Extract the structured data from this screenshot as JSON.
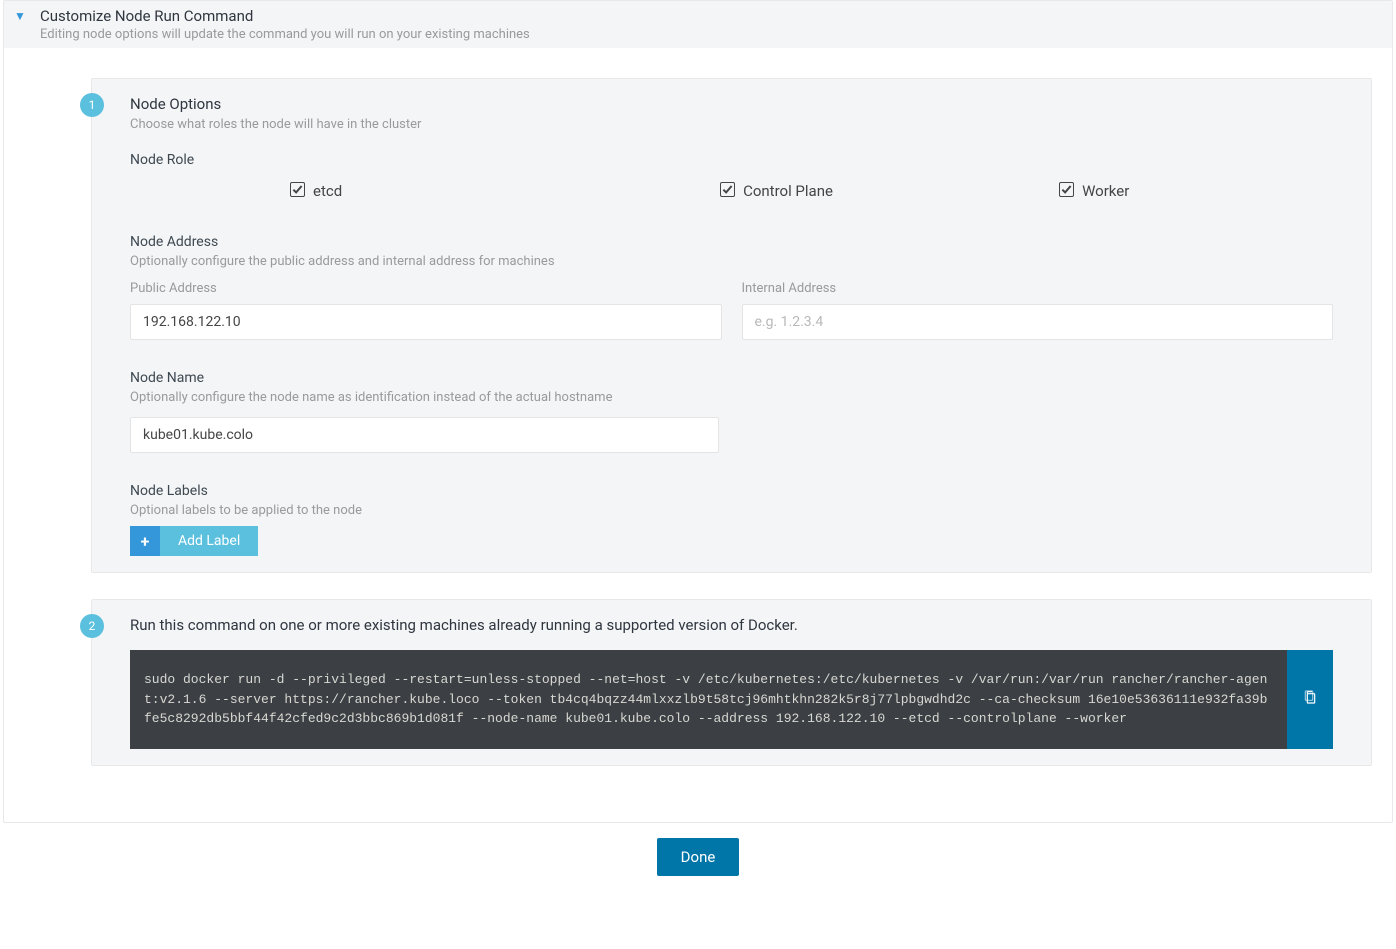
{
  "header": {
    "title": "Customize Node Run Command",
    "subtitle": "Editing node options will update the command you will run on your existing machines"
  },
  "step1": {
    "num": "1",
    "title": "Node Options",
    "subtitle": "Choose what roles the node will have in the cluster",
    "role_label": "Node Role",
    "roles": {
      "etcd": "etcd",
      "control_plane": "Control Plane",
      "worker": "Worker"
    },
    "address": {
      "label": "Node Address",
      "sub": "Optionally configure the public address and internal address for machines",
      "public_label": "Public Address",
      "public_value": "192.168.122.10",
      "internal_label": "Internal Address",
      "internal_placeholder": "e.g. 1.2.3.4"
    },
    "name": {
      "label": "Node Name",
      "sub": "Optionally configure the node name as identification instead of the actual hostname",
      "value": "kube01.kube.colo"
    },
    "labels": {
      "label": "Node Labels",
      "sub": "Optional labels to be applied to the node",
      "add_btn": "Add Label"
    }
  },
  "step2": {
    "num": "2",
    "title": "Run this command on one or more existing machines already running a supported version of Docker.",
    "command": "sudo docker run -d --privileged --restart=unless-stopped --net=host -v /etc/kubernetes:/etc/kubernetes -v /var/run:/var/run rancher/rancher-agent:v2.1.6 --server https://rancher.kube.loco --token tb4cq4bqzz44mlxxzlb9t58tcj96mhtkhn282k5r8j77lpbgwdhd2c --ca-checksum 16e10e53636111e932fa39bfe5c8292db5bbf44f42cfed9c2d3bbc869b1d081f --node-name kube01.kube.colo --address 192.168.122.10 --etcd --controlplane --worker"
  },
  "footer": {
    "done": "Done"
  }
}
